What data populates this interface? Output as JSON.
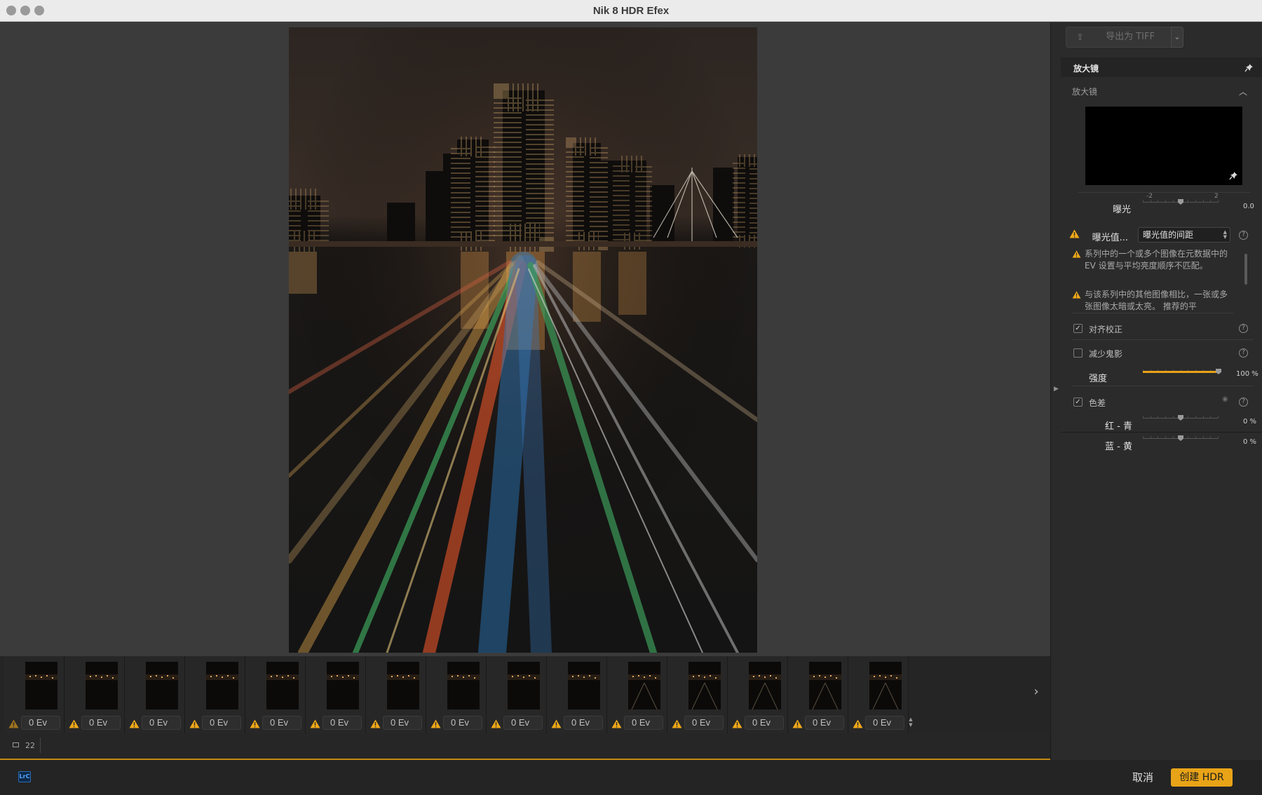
{
  "window": {
    "title": "Nik 8 HDR Efex"
  },
  "filmstrip": {
    "thumbnails": [
      {
        "ev": "0 Ev"
      },
      {
        "ev": "0 Ev"
      },
      {
        "ev": "0 Ev"
      },
      {
        "ev": "0 Ev"
      },
      {
        "ev": "0 Ev"
      },
      {
        "ev": "0 Ev"
      },
      {
        "ev": "0 Ev"
      },
      {
        "ev": "0 Ev"
      },
      {
        "ev": "0 Ev"
      },
      {
        "ev": "0 Ev"
      },
      {
        "ev": "0 Ev"
      },
      {
        "ev": "0 Ev"
      },
      {
        "ev": "0 Ev"
      },
      {
        "ev": "0 Ev"
      },
      {
        "ev": "0 Ev"
      }
    ],
    "prev_icon": "chevron-left-icon",
    "next_icon": "chevron-right-icon",
    "image_count": "22"
  },
  "panel": {
    "export_label": "导出为 TIFF",
    "section_title": "放大镜",
    "loupe_subtitle": "放大镜",
    "exposure": {
      "label": "曝光",
      "min_label": "-2",
      "max_label": "2",
      "value": "0.0",
      "level": 0.5
    },
    "ev_values": {
      "label": "曝光值...",
      "selected": "曝光值的间距"
    },
    "warnings": [
      "系列中的一个或多个图像在元数据中的 EV 设置与平均亮度顺序不匹配。",
      "与该系列中的其他图像相比，一张或多张图像太暗或太亮。 推荐的平"
    ],
    "align": {
      "label": "对齐校正",
      "checked": true
    },
    "deghost": {
      "label": "减少鬼影",
      "checked": false
    },
    "strength": {
      "label": "强度",
      "value": "100 %",
      "level": 1.0
    },
    "chromatic": {
      "label": "色差",
      "checked": true
    },
    "red_cyan": {
      "label": "红 - 青",
      "value": "0 %",
      "level": 0.5
    },
    "blue_yellow": {
      "label": "蓝 - 黄",
      "value": "0 %",
      "level": 0.5
    }
  },
  "footer": {
    "lrc_badge": "LrC",
    "cancel_label": "取消",
    "create_label": "创建 HDR"
  },
  "colors": {
    "accent": "#e8a317",
    "warning": "#f0a818"
  }
}
